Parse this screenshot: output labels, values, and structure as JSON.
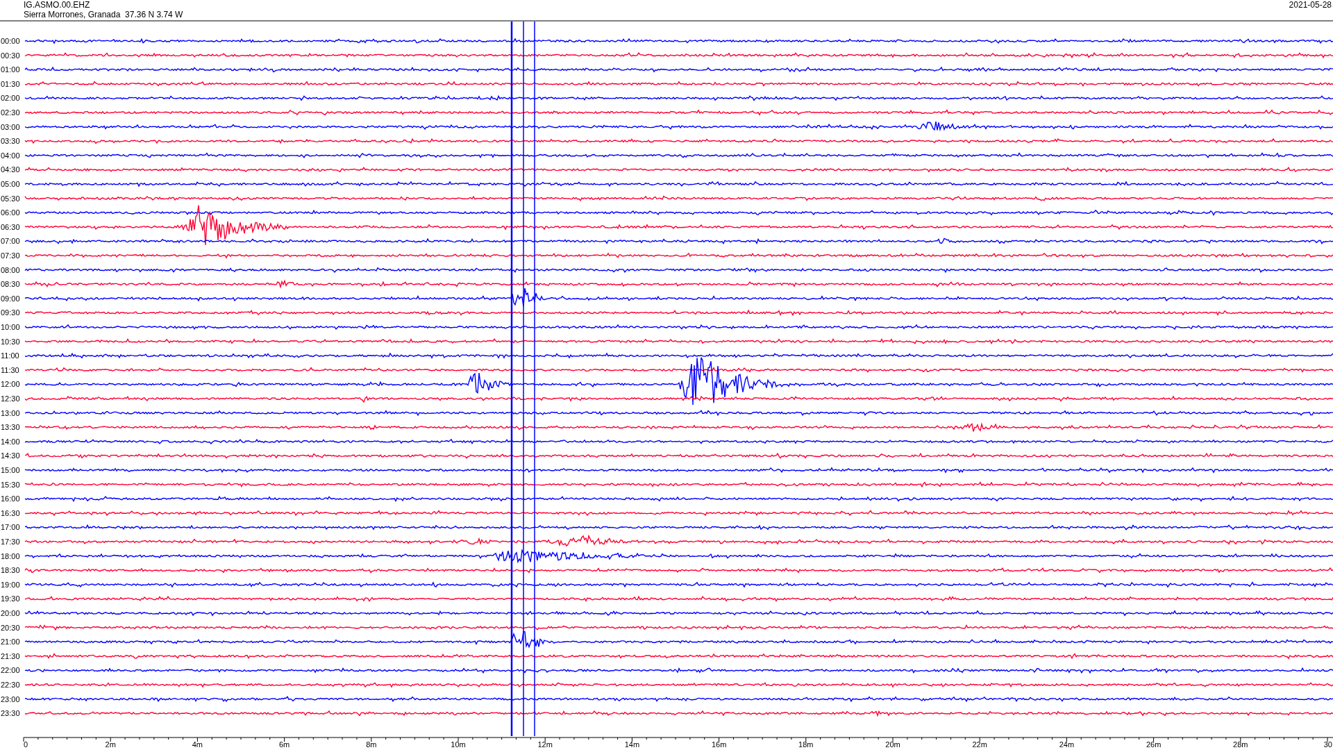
{
  "header": {
    "station": "IG.ASMO.00.EHZ",
    "location": "Sierra Morrones, Granada  37.36 N 3.74 W",
    "date": "2021-05-28"
  },
  "rows": [
    {
      "time": "00:00",
      "color": "#0000ff"
    },
    {
      "time": "00:30",
      "color": "#ff0033"
    },
    {
      "time": "01:00",
      "color": "#0000ff"
    },
    {
      "time": "01:30",
      "color": "#ff0033"
    },
    {
      "time": "02:00",
      "color": "#0000ff"
    },
    {
      "time": "02:30",
      "color": "#ff0033"
    },
    {
      "time": "03:00",
      "color": "#0000ff"
    },
    {
      "time": "03:30",
      "color": "#ff0033"
    },
    {
      "time": "04:00",
      "color": "#0000ff"
    },
    {
      "time": "04:30",
      "color": "#ff0033"
    },
    {
      "time": "05:00",
      "color": "#0000ff"
    },
    {
      "time": "05:30",
      "color": "#ff0033"
    },
    {
      "time": "06:00",
      "color": "#0000ff"
    },
    {
      "time": "06:30",
      "color": "#ff0033"
    },
    {
      "time": "07:00",
      "color": "#0000ff"
    },
    {
      "time": "07:30",
      "color": "#ff0033"
    },
    {
      "time": "08:00",
      "color": "#0000ff"
    },
    {
      "time": "08:30",
      "color": "#ff0033"
    },
    {
      "time": "09:00",
      "color": "#0000ff"
    },
    {
      "time": "09:30",
      "color": "#ff0033"
    },
    {
      "time": "10:00",
      "color": "#0000ff"
    },
    {
      "time": "10:30",
      "color": "#ff0033"
    },
    {
      "time": "11:00",
      "color": "#0000ff"
    },
    {
      "time": "11:30",
      "color": "#ff0033"
    },
    {
      "time": "12:00",
      "color": "#0000ff"
    },
    {
      "time": "12:30",
      "color": "#ff0033"
    },
    {
      "time": "13:00",
      "color": "#0000ff"
    },
    {
      "time": "13:30",
      "color": "#ff0033"
    },
    {
      "time": "14:00",
      "color": "#0000ff"
    },
    {
      "time": "14:30",
      "color": "#ff0033"
    },
    {
      "time": "15:00",
      "color": "#0000ff"
    },
    {
      "time": "15:30",
      "color": "#ff0033"
    },
    {
      "time": "16:00",
      "color": "#0000ff"
    },
    {
      "time": "16:30",
      "color": "#ff0033"
    },
    {
      "time": "17:00",
      "color": "#0000ff"
    },
    {
      "time": "17:30",
      "color": "#ff0033"
    },
    {
      "time": "18:00",
      "color": "#0000ff"
    },
    {
      "time": "18:30",
      "color": "#ff0033"
    },
    {
      "time": "19:00",
      "color": "#0000ff"
    },
    {
      "time": "19:30",
      "color": "#ff0033"
    },
    {
      "time": "20:00",
      "color": "#0000ff"
    },
    {
      "time": "20:30",
      "color": "#ff0033"
    },
    {
      "time": "21:00",
      "color": "#0000ff"
    },
    {
      "time": "21:30",
      "color": "#ff0033"
    },
    {
      "time": "22:00",
      "color": "#0000ff"
    },
    {
      "time": "22:30",
      "color": "#ff0033"
    },
    {
      "time": "23:00",
      "color": "#0000ff"
    },
    {
      "time": "23:30",
      "color": "#ff0033"
    }
  ],
  "x_axis": {
    "labels": [
      "0",
      "2m",
      "4m",
      "6m",
      "8m",
      "10m",
      "12m",
      "14m",
      "16m",
      "18m",
      "20m",
      "22m",
      "24m",
      "26m",
      "28m",
      "30"
    ]
  }
}
